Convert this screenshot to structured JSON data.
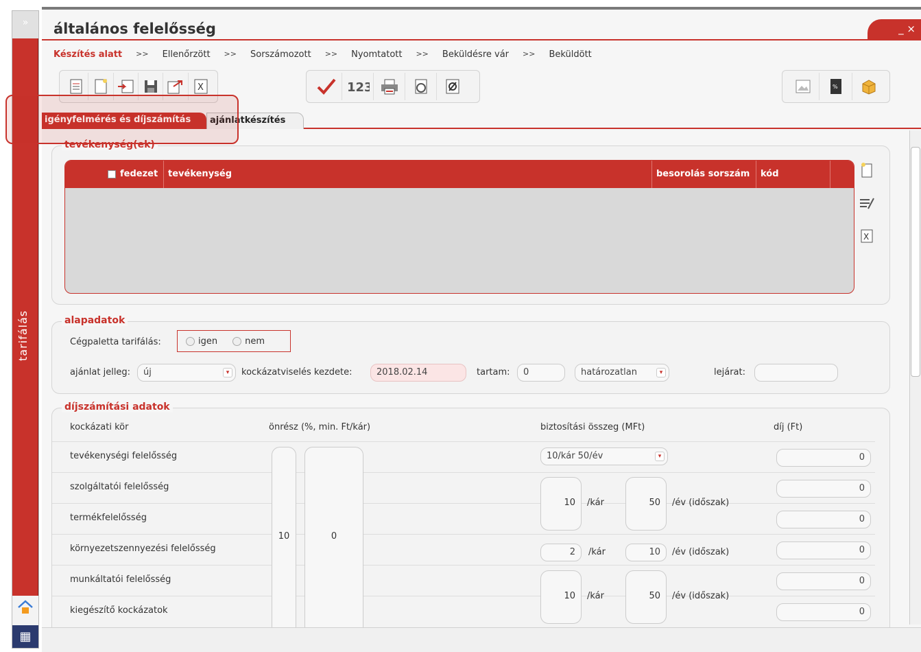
{
  "sidebar": {
    "expand_icon": "»",
    "section_label": "tarifálás"
  },
  "window": {
    "title": "általános felelősség",
    "controls": "_ ×"
  },
  "workflow": {
    "steps": [
      "Készítés alatt",
      "Ellenőrzött",
      "Sorszámozott",
      "Nyomtatott",
      "Beküldésre vár",
      "Beküldött"
    ],
    "separator": ">>"
  },
  "tabs": {
    "active": "igényfelmérés és díjszámítás",
    "inactive": "ajánlatkészítés"
  },
  "activities": {
    "legend": "tevékenység(ek)",
    "columns": [
      "fedezet",
      "tevékenység",
      "besorolás sorszám",
      "kód"
    ]
  },
  "basic": {
    "legend": "alapadatok",
    "cegpaletta_label": "Cégpaletta tarifálás:",
    "option_yes": "igen",
    "option_no": "nem",
    "offer_type_label": "ajánlat jelleg:",
    "offer_type_value": "új",
    "start_label": "kockázatviselés kezdete:",
    "start_value": "2018.02.14",
    "duration_label": "tartam:",
    "duration_value": "0",
    "duration_type": "határozatlan",
    "expiry_label": "lejárat:",
    "expiry_value": ""
  },
  "pricing": {
    "legend": "díjszámítási adatok",
    "headers": {
      "risk": "kockázati kör",
      "deductible": "önrész (%, min. Ft/kár)",
      "sum": "biztosítási összeg (MFt)",
      "fee": "díj (Ft)"
    },
    "rows": [
      {
        "label": "tevékenységi felelősség",
        "fee": "0"
      },
      {
        "label": "szolgáltatói felelősség",
        "fee": "0"
      },
      {
        "label": "termékfelelősség",
        "fee": "0"
      },
      {
        "label": "környezetszennyezési felelősség",
        "fee": "0"
      },
      {
        "label": "munkáltatói felelősség",
        "fee": "0"
      },
      {
        "label": "kiegészítő kockázatok",
        "fee": "0"
      }
    ],
    "deductible_pct": "10",
    "deductible_min": "0",
    "limit_select": "10/kár 50/év",
    "block1": {
      "per_claim": "10",
      "per_year": "50"
    },
    "env": {
      "per_claim": "2",
      "per_year": "10"
    },
    "block2": {
      "per_claim": "10",
      "per_year": "50"
    },
    "unit_claim": "/kár",
    "unit_year": "/év (időszak)"
  }
}
